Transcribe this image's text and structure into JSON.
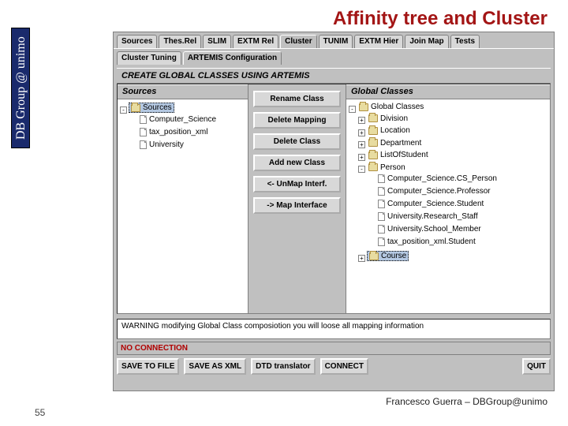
{
  "slide": {
    "title": "Affinity tree and Cluster",
    "sidebar_label": "DB Group @ unimo",
    "page_number": "55",
    "footer": "Francesco Guerra – DBGroup@unimo"
  },
  "tabs": {
    "top": [
      "Sources",
      "Thes.Rel",
      "SLIM",
      "EXTM Rel",
      "Cluster",
      "TUNIM",
      "EXTM Hier",
      "Join Map",
      "Tests"
    ],
    "top_active": 4,
    "sub": [
      "Cluster Tuning",
      "ARTEMIS Configuration"
    ],
    "sub_active": 1
  },
  "panel": {
    "header": "CREATE GLOBAL CLASSES USING ARTEMIS",
    "left_header": "Sources",
    "right_header": "Global Classes"
  },
  "sources_tree": {
    "root": "Sources",
    "children": [
      "Computer_Science",
      "tax_position_xml",
      "University"
    ]
  },
  "global_tree": {
    "root": "Global Classes",
    "items": [
      {
        "label": "Division",
        "children": []
      },
      {
        "label": "Location",
        "children": []
      },
      {
        "label": "Department",
        "children": []
      },
      {
        "label": "ListOfStudent",
        "children": []
      },
      {
        "label": "Person",
        "children": [
          "Computer_Science.CS_Person",
          "Computer_Science.Professor",
          "Computer_Science.Student",
          "University.Research_Staff",
          "University.School_Member",
          "tax_position_xml.Student"
        ]
      },
      {
        "label": "Course",
        "children": []
      }
    ],
    "selected": "Course"
  },
  "mid_buttons": [
    "Rename Class",
    "Delete Mapping",
    "Delete Class",
    "Add new Class",
    "<- UnMap Interf.",
    "-> Map Interface"
  ],
  "warning_text": "WARNING modifying Global Class composiotion you will loose all mapping information",
  "status_text": "NO CONNECTION",
  "bottom_buttons": {
    "left": [
      "SAVE TO FILE",
      "SAVE AS XML",
      "DTD translator",
      "CONNECT"
    ],
    "right": [
      "QUIT"
    ]
  }
}
